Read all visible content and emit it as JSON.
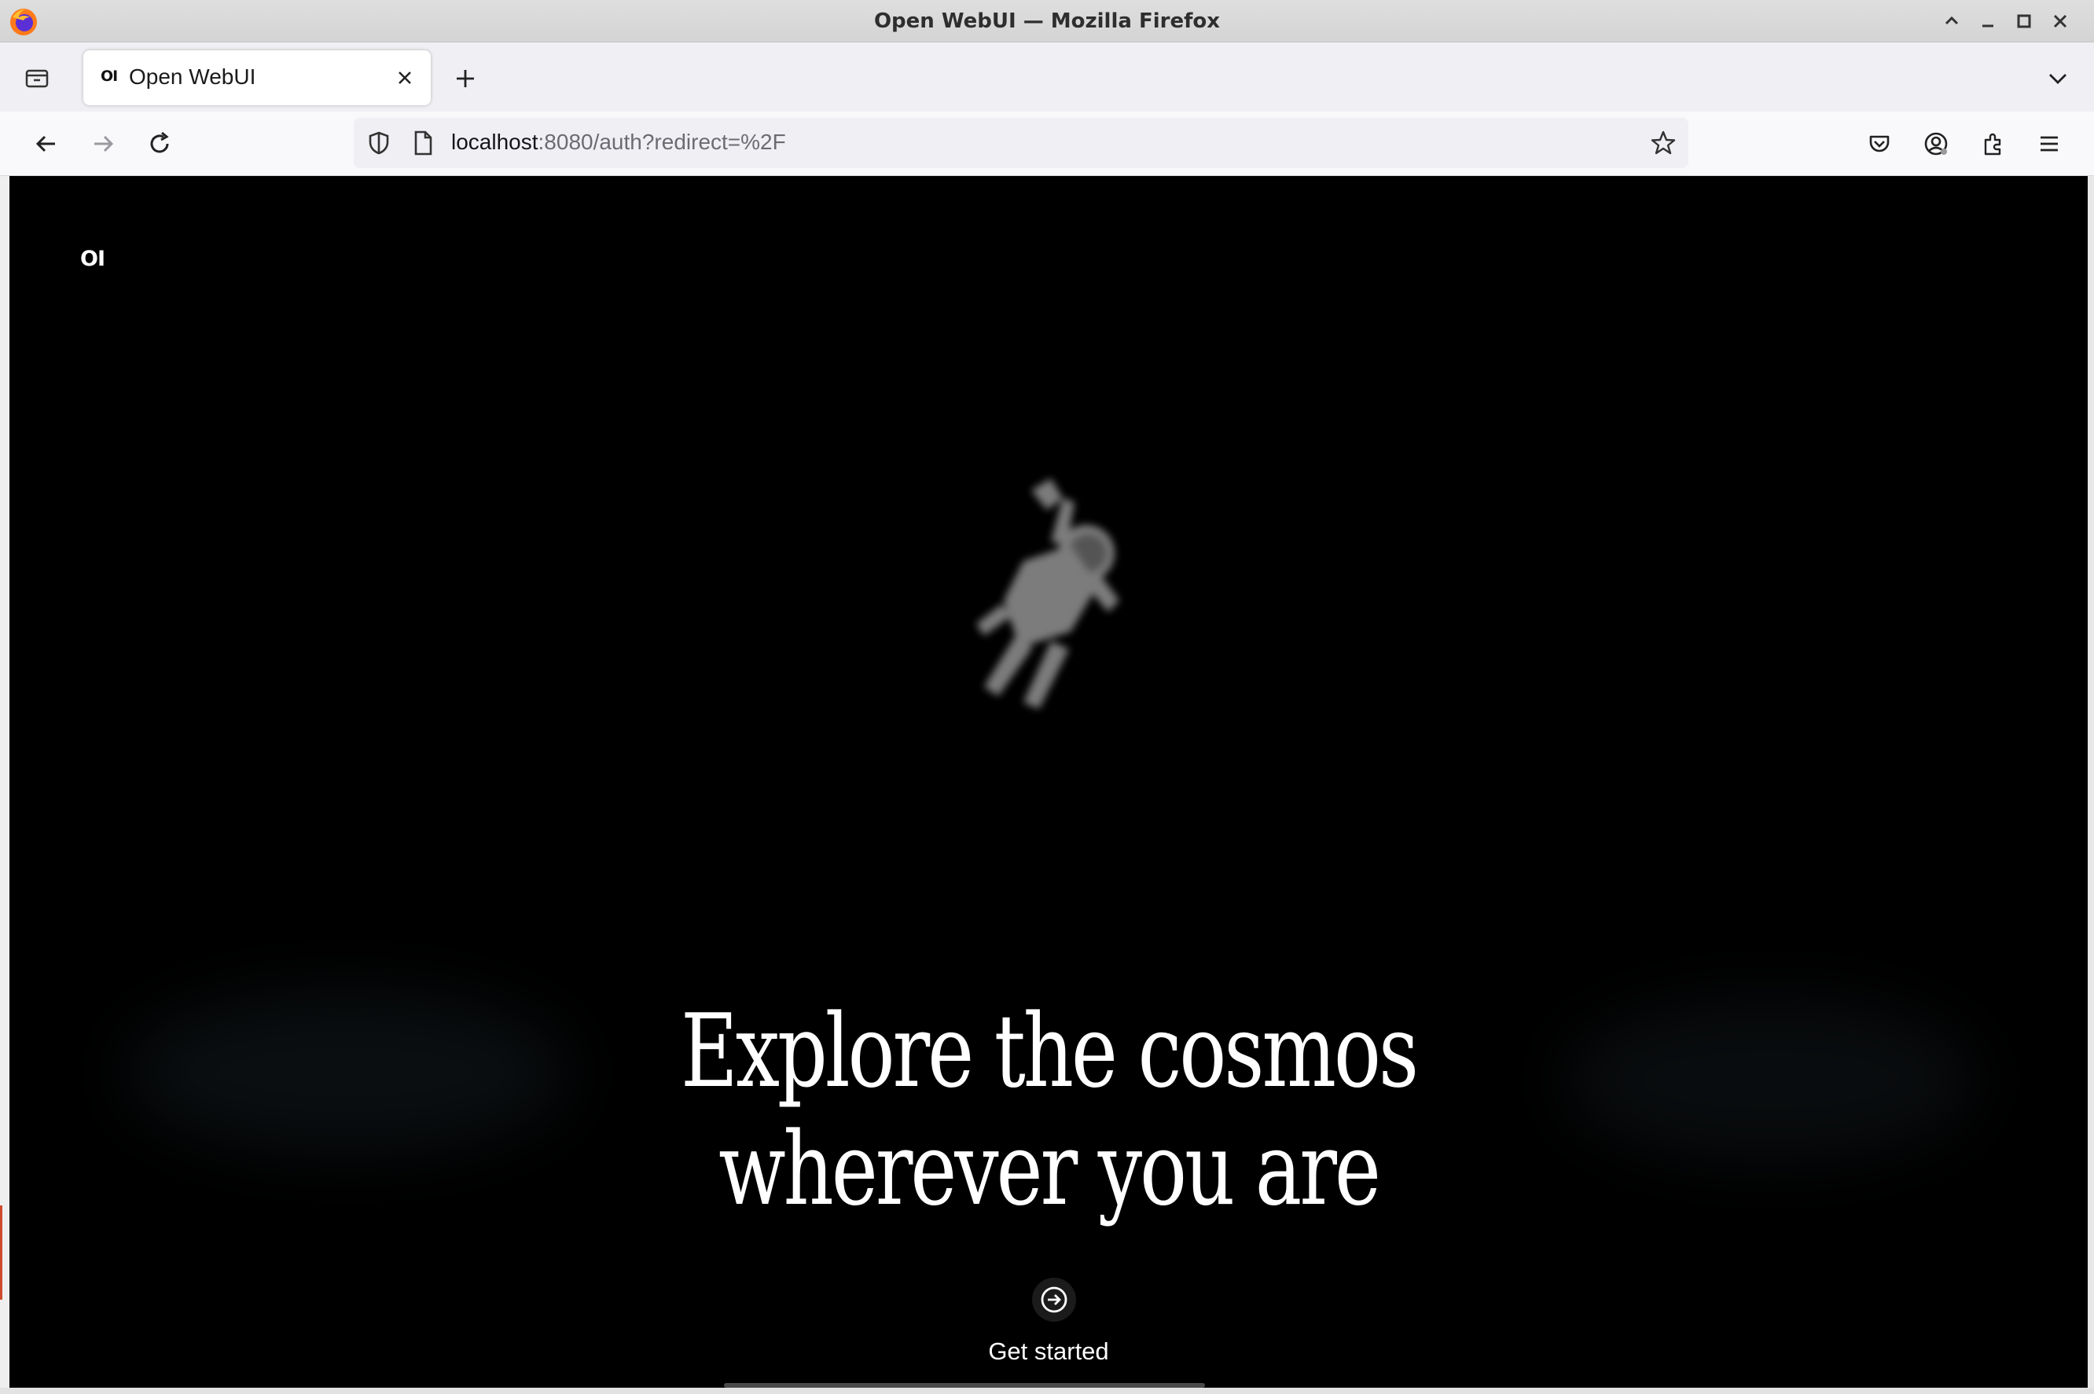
{
  "window": {
    "title": "Open WebUI — Mozilla Firefox"
  },
  "tabs": [
    {
      "favicon_text": "OI",
      "title": "Open WebUI",
      "active": true
    }
  ],
  "navbar": {
    "url_host": "localhost",
    "url_rest": ":8080/auth?redirect=%2F"
  },
  "page": {
    "logo_text": "OI",
    "headline_line1": "Explore the cosmos",
    "headline_line2": "wherever you are",
    "cta_label": "Get started"
  },
  "icons": {
    "app": "firefox-icon",
    "window_controls": [
      "maximize-up-icon",
      "minimize-icon",
      "restore-icon",
      "close-icon"
    ],
    "nav": [
      "back-arrow-icon",
      "forward-arrow-icon",
      "reload-icon"
    ],
    "toolbar": [
      "pocket-icon",
      "account-icon",
      "extensions-icon",
      "hamburger-menu-icon"
    ],
    "cta": "arrow-circle-right-icon"
  },
  "colors": {
    "page_background": "#000000",
    "headline": "#ffffff",
    "titlebar": "#d8d8d8",
    "tabstrip": "#f0f0f4"
  }
}
